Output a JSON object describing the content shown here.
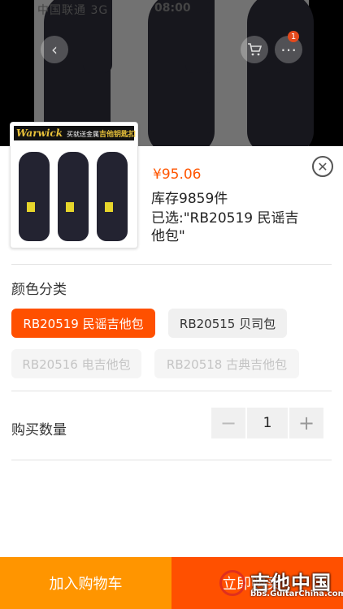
{
  "status_bar": {
    "carrier": "中国联通 3G",
    "time": "08:00"
  },
  "header": {
    "back_icon": "chevron-left-icon",
    "cart_icon": "cart-icon",
    "cart_badge": "1"
  },
  "product": {
    "thumbnail_brand": "Warwick",
    "thumbnail_promo_prefix": "买就送金属",
    "thumbnail_promo_highlight": "吉他钥匙扣",
    "price": "¥95.06",
    "stock": "库存9859件",
    "selected": "已选:\"RB20519 民谣吉他包\""
  },
  "color_section": {
    "title": "颜色分类",
    "options": [
      {
        "label": "RB20519 民谣吉他包",
        "state": "selected"
      },
      {
        "label": "RB20515 贝司包",
        "state": "normal"
      },
      {
        "label": "RB20516 电吉他包",
        "state": "disabled"
      },
      {
        "label": "RB20518 古典吉他包",
        "state": "disabled"
      }
    ]
  },
  "quantity": {
    "label": "购买数量",
    "value": "1",
    "minus": "−",
    "plus": "+"
  },
  "footer": {
    "add_to_cart": "加入购物车",
    "buy_now": "立即购买"
  },
  "watermark": {
    "title": "吉他中国",
    "url": "bbs.GuitarChina.com"
  },
  "colors": {
    "accent": "#ff5000",
    "cart": "#ff9500",
    "price": "#ff5500"
  }
}
